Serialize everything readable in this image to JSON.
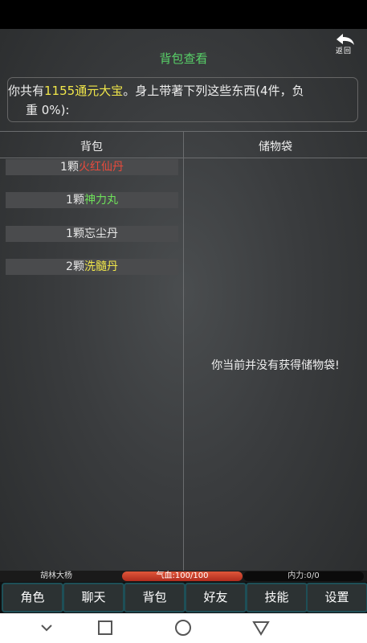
{
  "screen": {
    "title": "背包查看",
    "back_label": "返回"
  },
  "summary": {
    "prefix": "你共有",
    "money": "1155通元大宝",
    "suffix": "。身上带著下列这些东西(4件，负",
    "line2": "重 0%):"
  },
  "columns": {
    "bag": "背包",
    "storage": "储物袋"
  },
  "items": [
    {
      "count": "1颗",
      "name": "火红仙丹",
      "color": "#e84a3c"
    },
    {
      "count": "1颗",
      "name": "神力丸",
      "color": "#6ee05a"
    },
    {
      "count": "1颗",
      "name": "忘尘丹",
      "color": "#e8e8e8"
    },
    {
      "count": "2颗",
      "name": "洗髓丹",
      "color": "#f0e64a"
    }
  ],
  "storage_empty_message": "你当前并没有获得储物袋!",
  "status": {
    "character_name": "胡林大杨",
    "hp_text": "气血:100/100",
    "mp_text": "内力:0/0"
  },
  "tabs": [
    "角色",
    "聊天",
    "背包",
    "好友",
    "技能",
    "设置"
  ],
  "colors": {
    "title_green": "#58d068",
    "highlight_yellow": "#f0e64a",
    "tab_border": "#1e4f57",
    "hp_red": "#c0392b"
  },
  "navigation": {
    "icons": [
      "chevron-down-icon",
      "square-recents-icon",
      "circle-home-icon",
      "triangle-back-icon"
    ]
  }
}
